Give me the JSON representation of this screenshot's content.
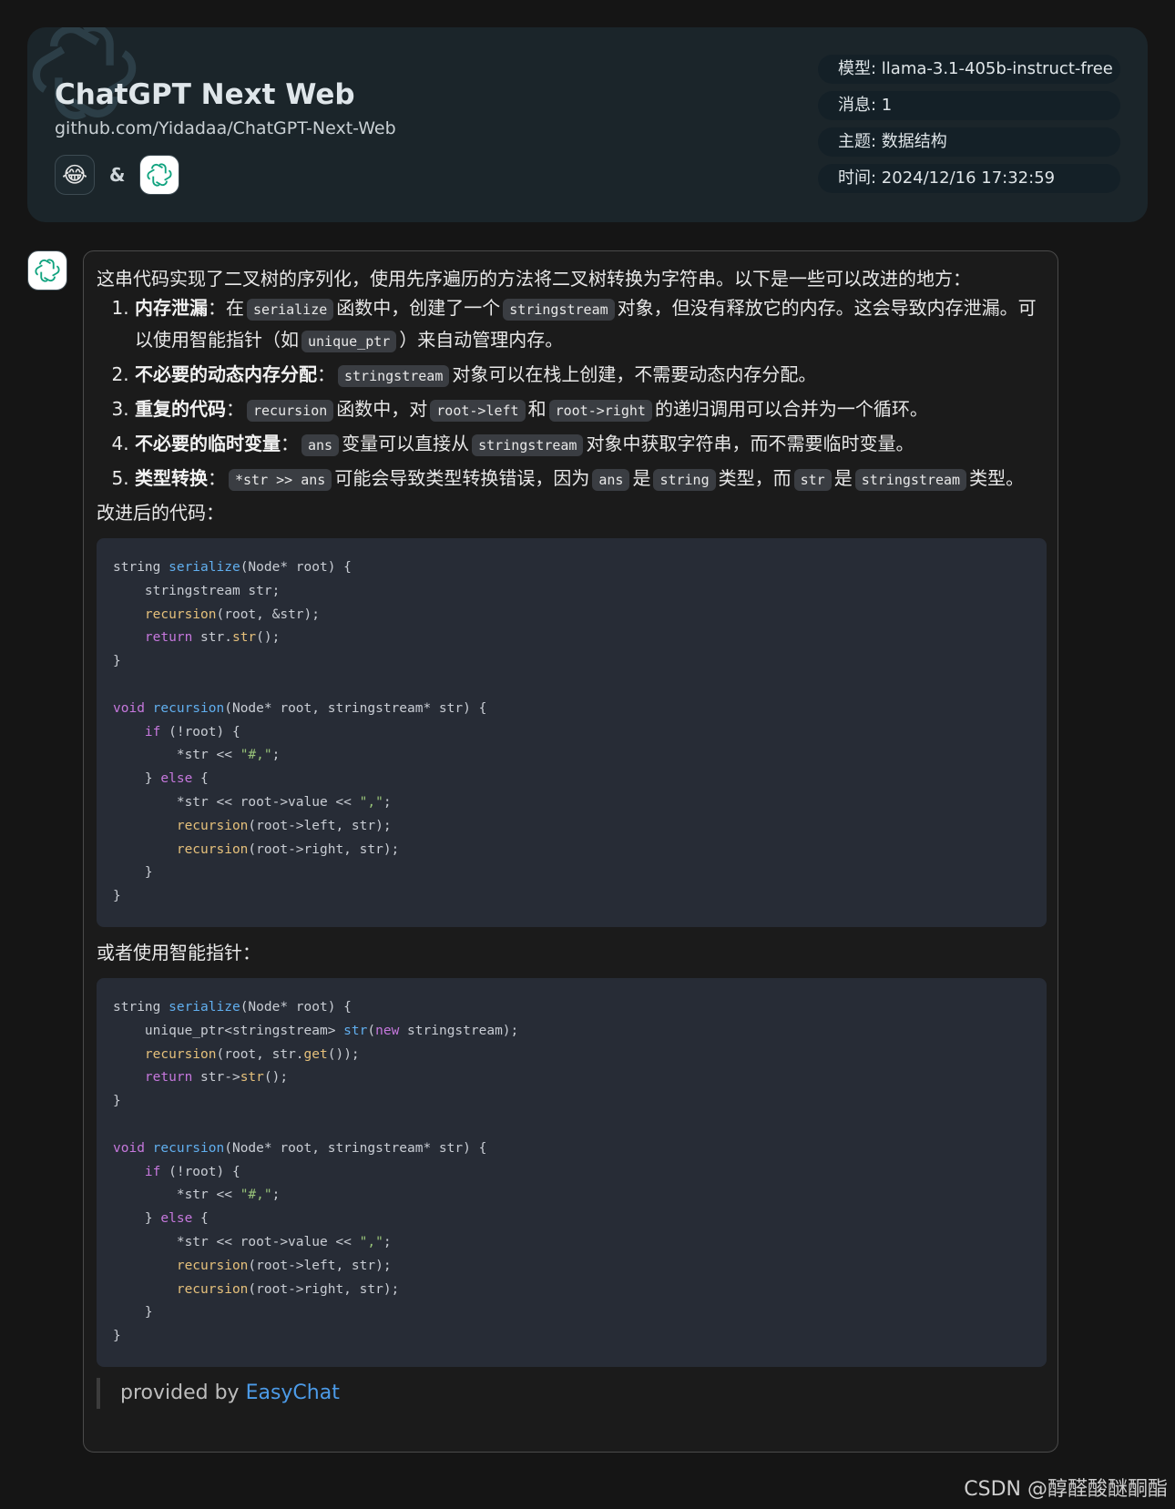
{
  "header": {
    "title": "ChatGPT Next Web",
    "subtitle": "github.com/Yidadaa/ChatGPT-Next-Web",
    "user_avatar_emoji": "😂",
    "amp": "&",
    "bot_avatar_icon": "openai-logo-icon",
    "meta": {
      "model": "模型: llama-3.1-405b-instruct-free",
      "messages": "消息: 1",
      "topic": "主题: 数据结构",
      "time": "时间: 2024/12/16 17:32:59"
    }
  },
  "message": {
    "intro": "这串代码实现了二叉树的序列化，使用先序遍历的方法将二叉树转换为字符串。以下是一些可以改进的地方：",
    "items": [
      {
        "title": "内存泄漏",
        "parts": [
          "在",
          "serialize",
          "函数中，创建了一个",
          "stringstream",
          "对象，但没有释放它的内存。这会导致内存泄漏。可以使用智能指针（如",
          "unique_ptr",
          "）来自动管理内存。"
        ]
      },
      {
        "title": "不必要的动态内存分配",
        "parts": [
          "stringstream",
          "对象可以在栈上创建，不需要动态内存分配。"
        ]
      },
      {
        "title": "重复的代码",
        "parts": [
          "recursion",
          "函数中，对",
          "root->left",
          "和",
          "root->right",
          "的递归调用可以合并为一个循环。"
        ]
      },
      {
        "title": "不必要的临时变量",
        "parts": [
          "ans",
          "变量可以直接从",
          "stringstream",
          "对象中获取字符串，而不需要临时变量。"
        ]
      },
      {
        "title": "类型转换",
        "parts": [
          "*str >> ans",
          "可能会导致类型转换错误，因为",
          "ans",
          "是",
          "string",
          "类型，而",
          "str",
          "是",
          "stringstream",
          "类型。"
        ]
      }
    ],
    "improved_label": "改进后的代码：",
    "code1": [
      [
        [
          "",
          "string "
        ],
        [
          "fn",
          "serialize"
        ],
        [
          "",
          "(Node* root) {"
        ]
      ],
      [
        [
          "",
          "    stringstream str;"
        ]
      ],
      [
        [
          "",
          "    "
        ],
        [
          "call",
          "recursion"
        ],
        [
          "",
          "(root, &str);"
        ]
      ],
      [
        [
          "",
          "    "
        ],
        [
          "kw",
          "return"
        ],
        [
          "",
          " str."
        ],
        [
          "call",
          "str"
        ],
        [
          "",
          "();"
        ]
      ],
      [
        [
          "",
          "}"
        ]
      ],
      [
        [
          "",
          ""
        ]
      ],
      [
        [
          "kw",
          "void"
        ],
        [
          "",
          " "
        ],
        [
          "fn",
          "recursion"
        ],
        [
          "",
          "(Node* root, stringstream* str) {"
        ]
      ],
      [
        [
          "",
          "    "
        ],
        [
          "kw",
          "if"
        ],
        [
          "",
          " (!root) {"
        ]
      ],
      [
        [
          "",
          "        *str << "
        ],
        [
          "str",
          "\"#,\""
        ],
        [
          "",
          ";"
        ]
      ],
      [
        [
          "",
          "    } "
        ],
        [
          "kw",
          "else"
        ],
        [
          "",
          " {"
        ]
      ],
      [
        [
          "",
          "        *str << root->value << "
        ],
        [
          "str",
          "\",\""
        ],
        [
          "",
          ";"
        ]
      ],
      [
        [
          "",
          "        "
        ],
        [
          "call",
          "recursion"
        ],
        [
          "",
          "(root->left, str);"
        ]
      ],
      [
        [
          "",
          "        "
        ],
        [
          "call",
          "recursion"
        ],
        [
          "",
          "(root->right, str);"
        ]
      ],
      [
        [
          "",
          "    }"
        ]
      ],
      [
        [
          "",
          "}"
        ]
      ]
    ],
    "smart_label": "或者使用智能指针：",
    "code2": [
      [
        [
          "",
          "string "
        ],
        [
          "fn",
          "serialize"
        ],
        [
          "",
          "(Node* root) {"
        ]
      ],
      [
        [
          "",
          "    unique_ptr<stringstream> "
        ],
        [
          "fn",
          "str"
        ],
        [
          "",
          "("
        ],
        [
          "kw",
          "new"
        ],
        [
          "",
          " stringstream);"
        ]
      ],
      [
        [
          "",
          "    "
        ],
        [
          "call",
          "recursion"
        ],
        [
          "",
          "(root, str."
        ],
        [
          "call",
          "get"
        ],
        [
          "",
          "());"
        ]
      ],
      [
        [
          "",
          "    "
        ],
        [
          "kw",
          "return"
        ],
        [
          "",
          " str->"
        ],
        [
          "call",
          "str"
        ],
        [
          "",
          "();"
        ]
      ],
      [
        [
          "",
          "}"
        ]
      ],
      [
        [
          "",
          ""
        ]
      ],
      [
        [
          "kw",
          "void"
        ],
        [
          "",
          " "
        ],
        [
          "fn",
          "recursion"
        ],
        [
          "",
          "(Node* root, stringstream* str) {"
        ]
      ],
      [
        [
          "",
          "    "
        ],
        [
          "kw",
          "if"
        ],
        [
          "",
          " (!root) {"
        ]
      ],
      [
        [
          "",
          "        *str << "
        ],
        [
          "str",
          "\"#,\""
        ],
        [
          "",
          ";"
        ]
      ],
      [
        [
          "",
          "    } "
        ],
        [
          "kw",
          "else"
        ],
        [
          "",
          " {"
        ]
      ],
      [
        [
          "",
          "        *str << root->value << "
        ],
        [
          "str",
          "\",\""
        ],
        [
          "",
          ";"
        ]
      ],
      [
        [
          "",
          "        "
        ],
        [
          "call",
          "recursion"
        ],
        [
          "",
          "(root->left, str);"
        ]
      ],
      [
        [
          "",
          "        "
        ],
        [
          "call",
          "recursion"
        ],
        [
          "",
          "(root->right, str);"
        ]
      ],
      [
        [
          "",
          "    }"
        ]
      ],
      [
        [
          "",
          "}"
        ]
      ]
    ],
    "provided_prefix": "provided by ",
    "provided_link": "EasyChat"
  },
  "watermark": "CSDN @醇醛酸醚酮酯"
}
